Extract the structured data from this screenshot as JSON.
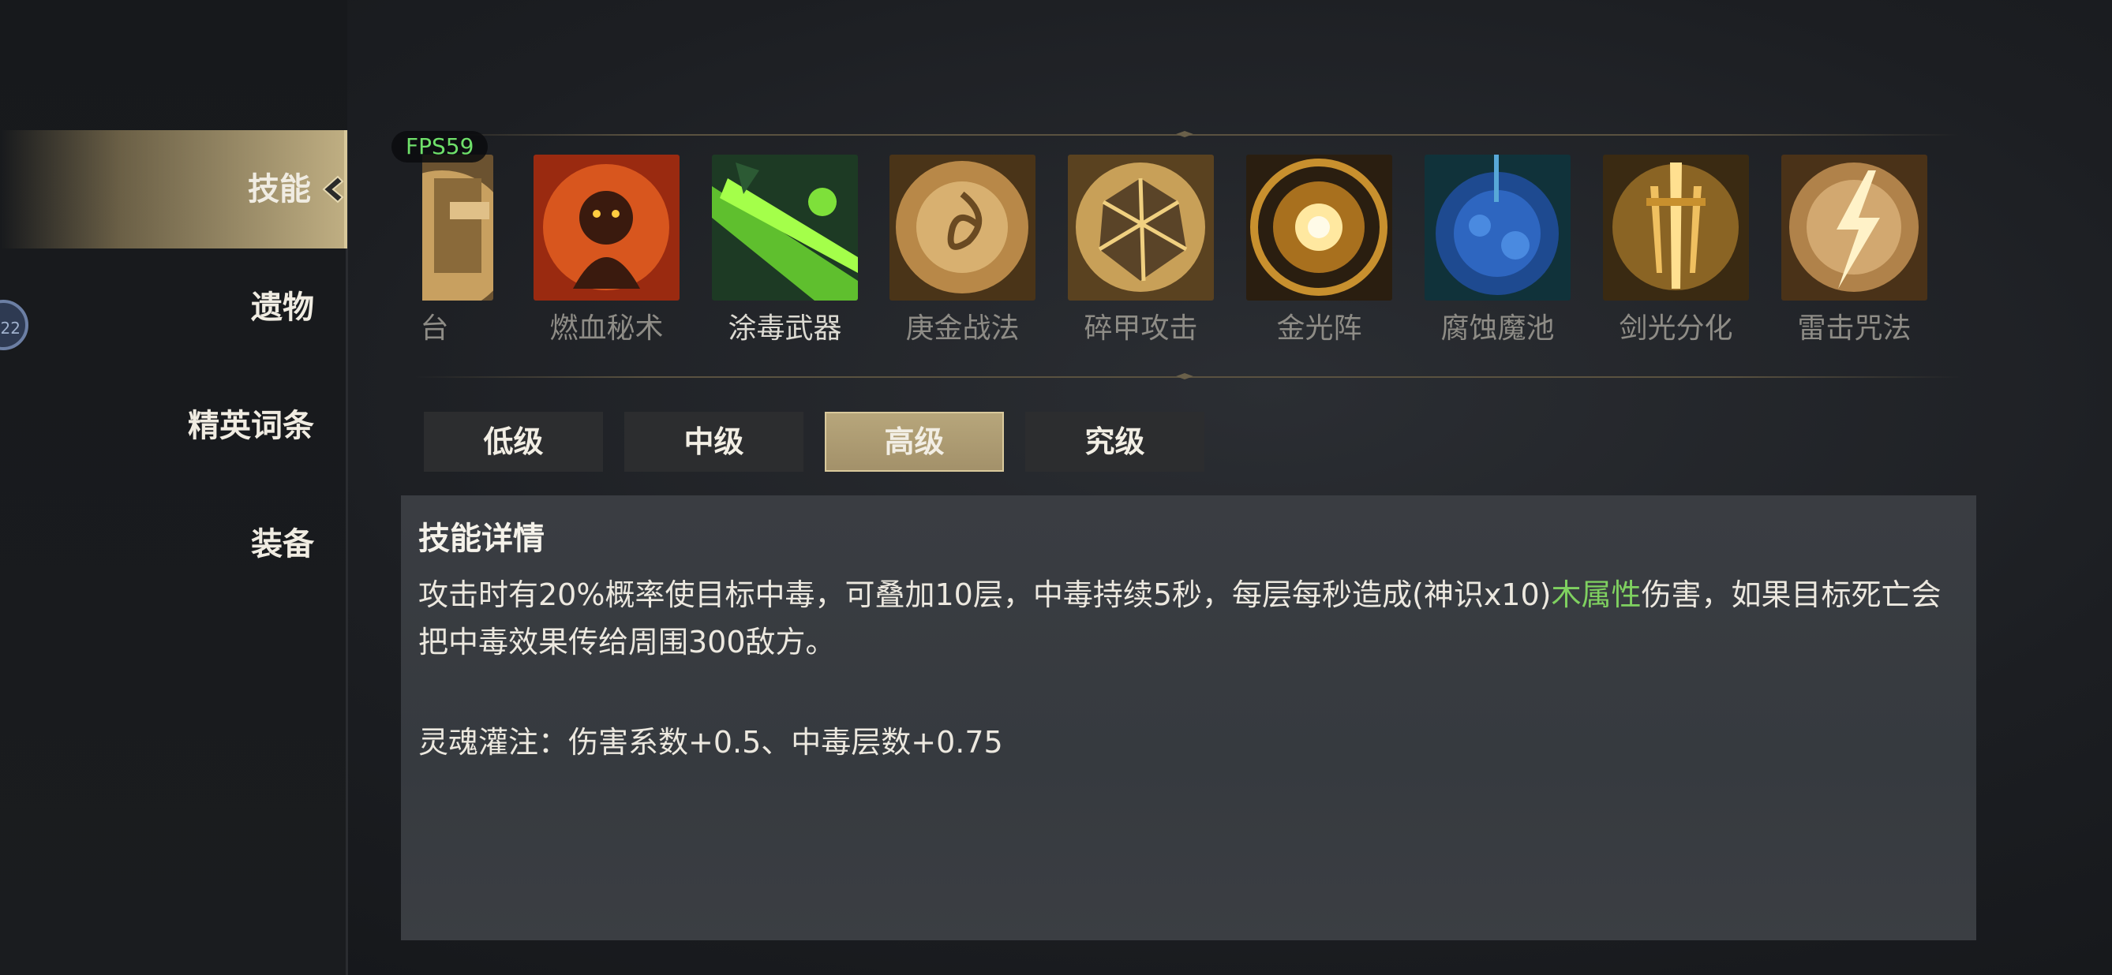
{
  "nav": {
    "items": [
      {
        "label": "技能"
      },
      {
        "label": "遗物"
      },
      {
        "label": "精英词条"
      },
      {
        "label": "装备"
      }
    ]
  },
  "edge_badge": "22",
  "fps": "FPS59",
  "skills": [
    {
      "name": "炮台",
      "icon": "turret-icon"
    },
    {
      "name": "燃血秘术",
      "icon": "burning-blood-icon"
    },
    {
      "name": "涂毒武器",
      "icon": "poison-weapon-icon"
    },
    {
      "name": "庚金战法",
      "icon": "metal-art-icon"
    },
    {
      "name": "碎甲攻击",
      "icon": "armor-break-icon"
    },
    {
      "name": "金光阵",
      "icon": "golden-array-icon"
    },
    {
      "name": "腐蚀魔池",
      "icon": "corrosion-pool-icon"
    },
    {
      "name": "剑光分化",
      "icon": "sword-split-icon"
    },
    {
      "name": "雷击咒法",
      "icon": "thunder-curse-icon"
    }
  ],
  "tiers": [
    {
      "label": "低级"
    },
    {
      "label": "中级"
    },
    {
      "label": "高级"
    },
    {
      "label": "究级"
    }
  ],
  "detail": {
    "title": "技能详情",
    "desc_part1": "攻击时有20%概率使目标中毒，可叠加10层，中毒持续5秒，每层每秒造成(神识x10)",
    "desc_highlight": "木属性",
    "desc_part2": "伤害，如果目标死亡会把中毒效果传给周围300敌方。",
    "bonus": "灵魂灌注：伤害系数+0.5、中毒层数+0.75"
  },
  "colors": {
    "accent_gold": "#bfae82",
    "fps_green": "#6fe06a",
    "wood_attribute_green": "#7fd160"
  }
}
